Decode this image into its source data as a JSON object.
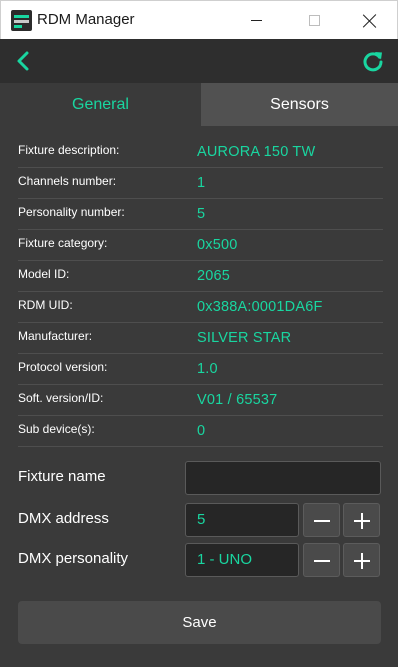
{
  "window": {
    "title": "RDM Manager",
    "icons": [
      "app-icon",
      "minimize-icon",
      "maximize-icon",
      "close-icon"
    ]
  },
  "toolbar": {
    "icons": [
      "back-chevron-icon",
      "refresh-icon"
    ],
    "accent": "#19d6a0"
  },
  "tabs": [
    {
      "label": "General",
      "active": true
    },
    {
      "label": "Sensors",
      "active": false
    }
  ],
  "info": [
    {
      "label": "Fixture description:",
      "value": "AURORA 150 TW"
    },
    {
      "label": "Channels number:",
      "value": "1"
    },
    {
      "label": "Personality number:",
      "value": "5"
    },
    {
      "label": "Fixture category:",
      "value": "0x500"
    },
    {
      "label": "Model ID:",
      "value": "2065"
    },
    {
      "label": "RDM UID:",
      "value": "0x388A:0001DA6F"
    },
    {
      "label": "Manufacturer:",
      "value": "SILVER STAR"
    },
    {
      "label": "Protocol version:",
      "value": "1.0"
    },
    {
      "label": "Soft. version/ID:",
      "value": "V01 / 65537"
    },
    {
      "label": "Sub device(s):",
      "value": "0"
    }
  ],
  "form": {
    "fixture_name": {
      "label": "Fixture name",
      "value": ""
    },
    "dmx_address": {
      "label": "DMX address",
      "value": "5"
    },
    "dmx_personality": {
      "label": "DMX personality",
      "value": "1 - UNO"
    }
  },
  "save_label": "Save",
  "colors": {
    "background": "#3a3a3a",
    "toolbar": "#2e2e2e",
    "accent": "#19d6a0",
    "inactive_tab": "#515151",
    "button": "#4a4a4a"
  }
}
